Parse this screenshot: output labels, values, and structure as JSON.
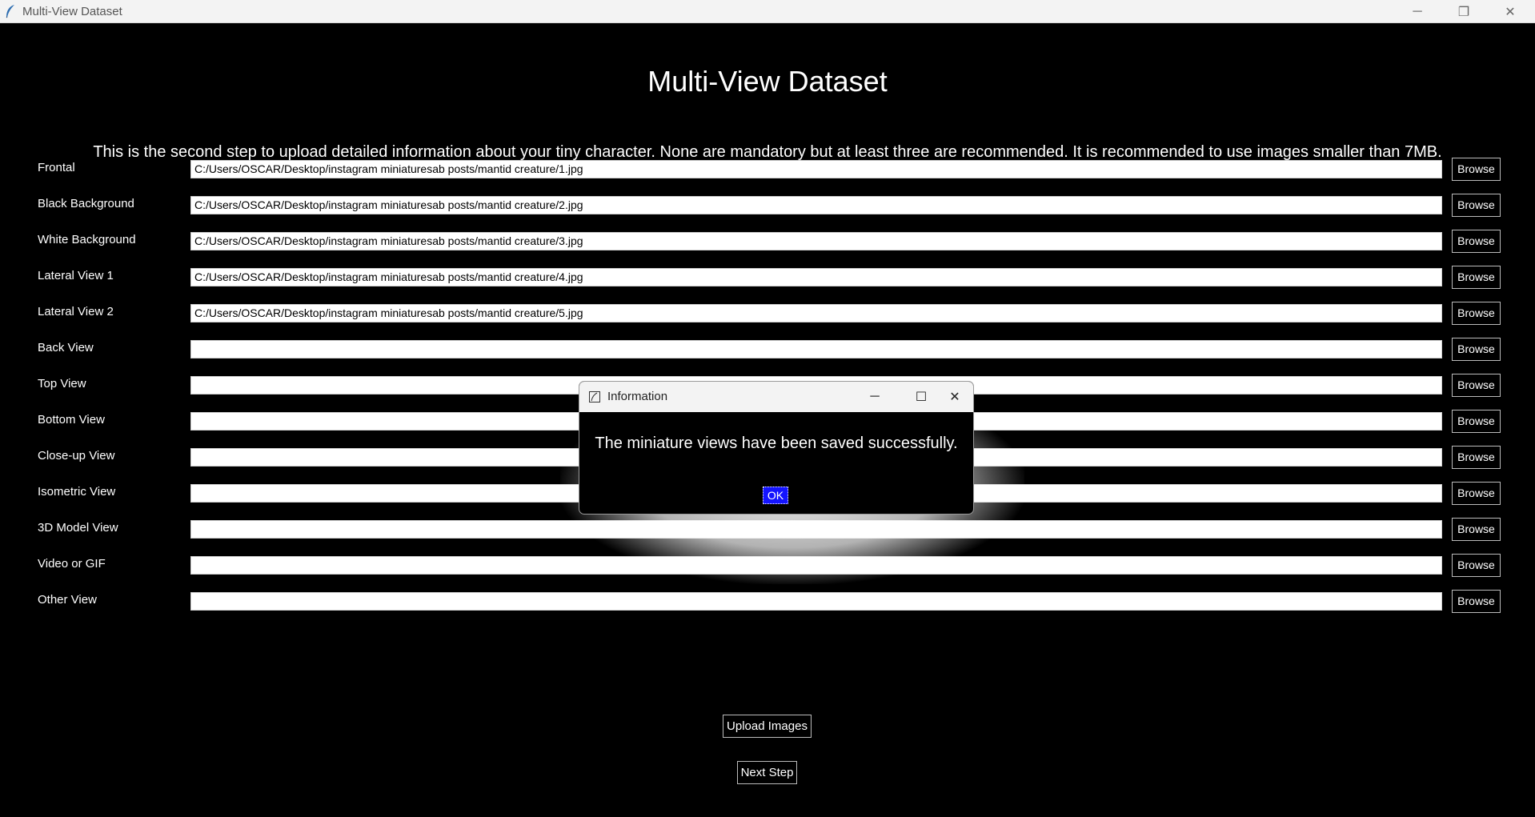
{
  "window": {
    "title": "Multi-View Dataset",
    "controls": {
      "minimize": "─",
      "maximize": "❐",
      "close": "✕"
    }
  },
  "main": {
    "heading": "Multi-View Dataset",
    "subtitle": "This is the second step to upload detailed information about your tiny character. None are mandatory but at least three are recommended. It is recommended to use images smaller than 7MB.",
    "browse_label": "Browse",
    "rows": [
      {
        "label": "Frontal",
        "value": "C:/Users/OSCAR/Desktop/instagram miniaturesab posts/mantid creature/1.jpg"
      },
      {
        "label": "Black Background",
        "value": "C:/Users/OSCAR/Desktop/instagram miniaturesab posts/mantid creature/2.jpg"
      },
      {
        "label": "White Background",
        "value": "C:/Users/OSCAR/Desktop/instagram miniaturesab posts/mantid creature/3.jpg"
      },
      {
        "label": "Lateral View 1",
        "value": "C:/Users/OSCAR/Desktop/instagram miniaturesab posts/mantid creature/4.jpg"
      },
      {
        "label": "Lateral View 2",
        "value": "C:/Users/OSCAR/Desktop/instagram miniaturesab posts/mantid creature/5.jpg"
      },
      {
        "label": "Back View",
        "value": ""
      },
      {
        "label": "Top View",
        "value": ""
      },
      {
        "label": "Bottom View",
        "value": ""
      },
      {
        "label": "Close-up View",
        "value": ""
      },
      {
        "label": "Isometric View",
        "value": ""
      },
      {
        "label": "3D Model View",
        "value": ""
      },
      {
        "label": "Video or GIF",
        "value": ""
      },
      {
        "label": "Other View",
        "value": ""
      }
    ],
    "upload_label": "Upload Images",
    "next_label": "Next Step"
  },
  "dialog": {
    "title": "Information",
    "message": "The miniature views have been saved successfully.",
    "ok_label": "OK",
    "controls": {
      "minimize": "─",
      "maximize": "☐",
      "close": "✕"
    }
  }
}
